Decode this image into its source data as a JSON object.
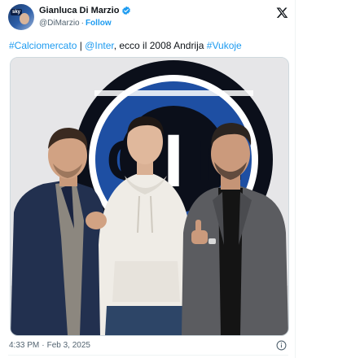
{
  "author": {
    "display_name": "Gianluca Di Marzio",
    "handle": "@DiMarzio",
    "follow_label": "Follow",
    "avatar_badge": "sky"
  },
  "tweet": {
    "hashtag_1": "#Calciomercato",
    "separator": " | ",
    "mention": "@Inter",
    "plain_text": ", ecco il 2008 Andrija ",
    "hashtag_2": "#Vukoje"
  },
  "meta": {
    "time": "4:33 PM",
    "date": "Feb 3, 2025"
  },
  "icons": {
    "verified": "verified-badge-icon",
    "x_logo": "x-logo-icon",
    "info": "info-icon"
  },
  "colors": {
    "link": "#1d9bf0",
    "text": "#0f1419",
    "muted": "#536471",
    "inter_blue": "#1e4fa3",
    "inter_dark": "#0b0f1a"
  }
}
